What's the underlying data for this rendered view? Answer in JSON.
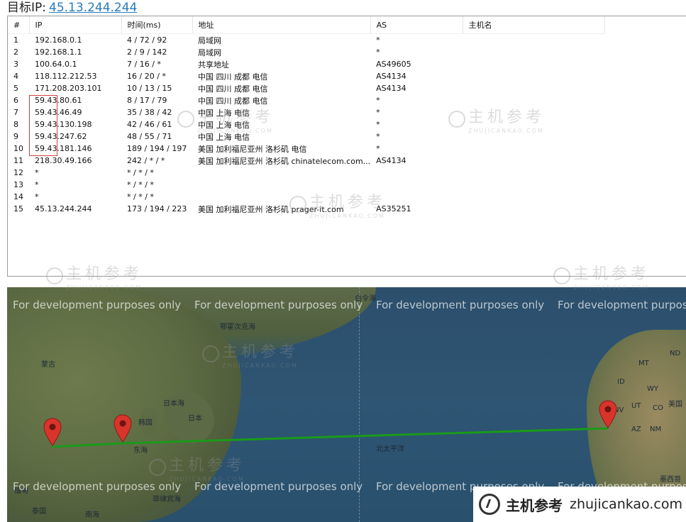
{
  "header": {
    "label": "目标IP:",
    "ip": "45.13.244.244"
  },
  "columns": [
    "#",
    "IP",
    "时间(ms)",
    "地址",
    "AS",
    "主机名"
  ],
  "rows": [
    {
      "n": "1",
      "ip": "192.168.0.1",
      "time": "4 / 72 / 92",
      "addr": "局域网",
      "as": "*",
      "host": ""
    },
    {
      "n": "2",
      "ip": "192.168.1.1",
      "time": "2 / 9 / 142",
      "addr": "局域网",
      "as": "*",
      "host": ""
    },
    {
      "n": "3",
      "ip": "100.64.0.1",
      "time": "7 / 16 / *",
      "addr": "共享地址",
      "as": "AS49605",
      "host": ""
    },
    {
      "n": "4",
      "ip": "118.112.212.53",
      "time": "16 / 20 / *",
      "addr": "中国 四川 成都 电信",
      "as": "AS4134",
      "host": ""
    },
    {
      "n": "5",
      "ip": "171.208.203.101",
      "time": "10 / 13 / 15",
      "addr": "中国 四川 成都 电信",
      "as": "AS4134",
      "host": ""
    },
    {
      "n": "6",
      "ip": "59.43.80.61",
      "time": "8 / 17 / 79",
      "addr": "中国 四川 成都 电信",
      "as": "*",
      "host": ""
    },
    {
      "n": "7",
      "ip": "59.43.46.49",
      "time": "35 / 38 / 42",
      "addr": "中国 上海 电信",
      "as": "*",
      "host": ""
    },
    {
      "n": "8",
      "ip": "59.43.130.198",
      "time": "42 / 46 / 61",
      "addr": "中国 上海 电信",
      "as": "*",
      "host": ""
    },
    {
      "n": "9",
      "ip": "59.43.247.62",
      "time": "48 / 55 / 71",
      "addr": "中国 上海 电信",
      "as": "*",
      "host": ""
    },
    {
      "n": "10",
      "ip": "59.43.181.146",
      "time": "189 / 194 / 197",
      "addr": "美国 加利福尼亚州 洛杉矶 电信",
      "as": "*",
      "host": ""
    },
    {
      "n": "11",
      "ip": "218.30.49.166",
      "time": "242 / * / *",
      "addr": "美国 加利福尼亚州 洛杉矶 chinatelecom.com...",
      "as": "AS4134",
      "host": ""
    },
    {
      "n": "12",
      "ip": "*",
      "time": "* / * / *",
      "addr": "",
      "as": "",
      "host": ""
    },
    {
      "n": "13",
      "ip": "*",
      "time": "* / * / *",
      "addr": "",
      "as": "",
      "host": ""
    },
    {
      "n": "14",
      "ip": "*",
      "time": "* / * / *",
      "addr": "",
      "as": "",
      "host": ""
    },
    {
      "n": "15",
      "ip": "45.13.244.244",
      "time": "173 / 194 / 223",
      "addr": "美国 加利福尼亚州 洛杉矶 prager-it.com",
      "as": "AS35251",
      "host": ""
    }
  ],
  "map": {
    "dev_notice": "For development purposes only",
    "labels": {
      "mongolia": "蒙古",
      "korea": "韩国",
      "japan": "日本",
      "sea_of_japan": "日本海",
      "east_sea": "东海",
      "north_pacific": "北太平洋",
      "thailand": "泰国",
      "usa": "美国",
      "mexico": "墨西哥",
      "okhotsk": "鄂霍次克海",
      "bering": "白令海",
      "philippine": "菲律宾海",
      "south_sea": "南海",
      "myanmar": "缅甸",
      "mt": "MT",
      "nd": "ND",
      "id": "ID",
      "wy": "WY",
      "nv": "NV",
      "ut": "UT",
      "az": "AZ",
      "nm": "NM",
      "co": "CO"
    }
  },
  "watermark": {
    "cn": "主机参考",
    "en": "ZHUJICANKAO.COM"
  },
  "brand": {
    "cn": "主机参考",
    "url": "zhujicankao.com"
  },
  "colors": {
    "route": "#1a9a1a",
    "pin": "#d9342b",
    "link": "#2a7bbd",
    "highlight_box": "#d04040"
  }
}
